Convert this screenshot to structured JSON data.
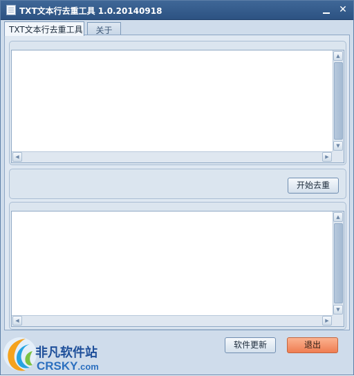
{
  "window": {
    "title": "TXT文本行去重工具 1.0.20140918",
    "minimize_label": "",
    "close_label": "✕"
  },
  "tabs": [
    {
      "label": "TXT文本行去重工具",
      "active": true
    },
    {
      "label": "关于",
      "active": false
    }
  ],
  "main": {
    "input_text": "",
    "output_text": "",
    "start_button_label": "开始去重"
  },
  "footer": {
    "update_button_label": "软件更新",
    "exit_button_label": "退出"
  },
  "watermark": {
    "chinese_text": "非凡软件站",
    "english_text": "CRSKY",
    "domain_suffix": ".com"
  },
  "colors": {
    "titlebar": "#2c5282",
    "window_bg": "#cfdceb",
    "exit_button": "#ef7d52"
  },
  "icons": {
    "app": "app-document-icon",
    "scroll_up": "triangle-up-icon",
    "scroll_down": "triangle-down-icon",
    "scroll_left": "triangle-left-icon",
    "scroll_right": "triangle-right-icon"
  }
}
